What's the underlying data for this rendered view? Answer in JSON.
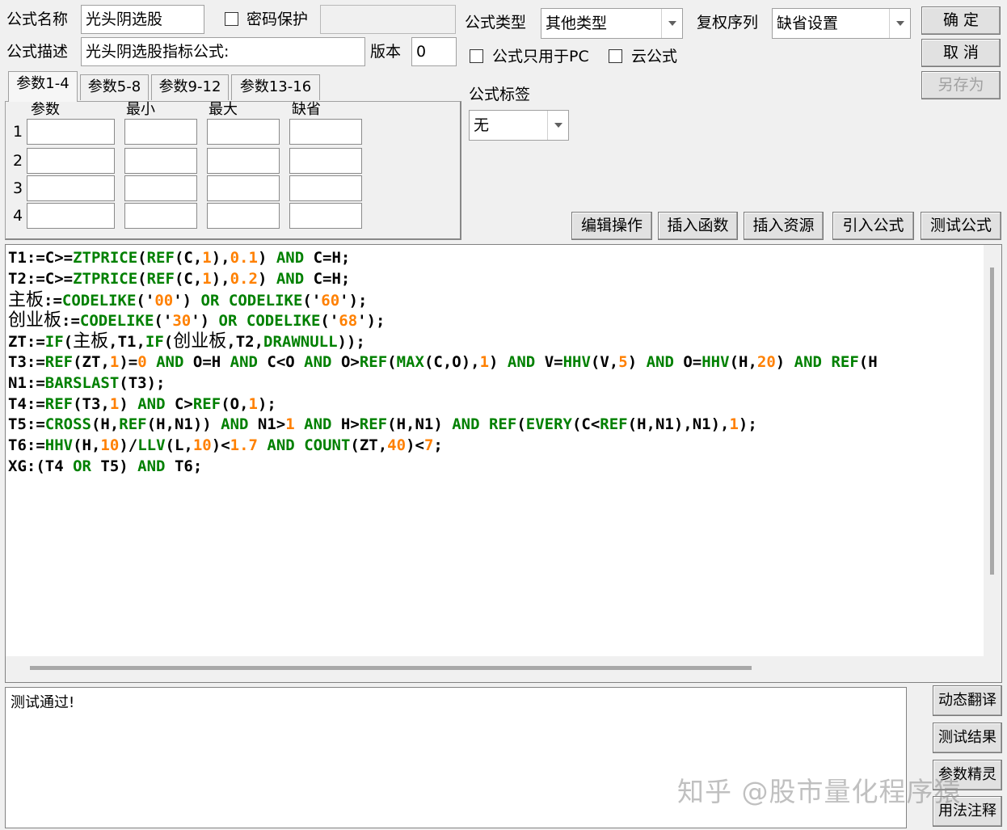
{
  "top": {
    "formula_name_label": "公式名称",
    "formula_name_value": "光头阴选股",
    "password_label": "密码保护",
    "password_value": "",
    "formula_desc_label": "公式描述",
    "formula_desc_value": "光头阴选股指标公式:",
    "version_label": "版本",
    "version_value": "0",
    "formula_type_label": "公式类型",
    "formula_type_value": "其他类型",
    "restore_label": "复权序列",
    "restore_value": "缺省设置",
    "pc_only_label": "公式只用于PC",
    "cloud_label": "云公式",
    "tag_label": "公式标签",
    "tag_value": "无"
  },
  "buttons": {
    "ok": "确  定",
    "cancel": "取  消",
    "save_as": "另存为"
  },
  "param_tabs": [
    "参数1-4",
    "参数5-8",
    "参数9-12",
    "参数13-16"
  ],
  "param_headers": [
    "参数",
    "最小",
    "最大",
    "缺省"
  ],
  "param_rows": [
    "1",
    "2",
    "3",
    "4"
  ],
  "toolbar": [
    "编辑操作",
    "插入函数",
    "插入资源",
    "引入公式",
    "测试公式"
  ],
  "code_lines": [
    "T1:=C>=ZTPRICE(REF(C,1),0.1) AND C=H;",
    "T2:=C>=ZTPRICE(REF(C,1),0.2) AND C=H;",
    "主板:=CODELIKE('00') OR CODELIKE('60');",
    "创业板:=CODELIKE('30') OR CODELIKE('68');",
    "ZT:=IF(主板,T1,IF(创业板,T2,DRAWNULL));",
    "T3:=REF(ZT,1)=0 AND O=H AND C<O AND O>REF(MAX(C,O),1) AND V=HHV(V,5) AND O=HHV(H,20) AND REF(H",
    "N1:=BARSLAST(T3);",
    "T4:=REF(T3,1) AND C>REF(O,1);",
    "T5:=CROSS(H,REF(H,N1)) AND N1>1 AND H>REF(H,N1) AND REF(EVERY(C<REF(H,N1),N1),1);",
    "T6:=HHV(H,10)/LLV(L,10)<1.7 AND COUNT(ZT,40)<7;",
    "XG:(T4 OR T5) AND T6;"
  ],
  "result_text": "测试通过!",
  "side_buttons": [
    "动态翻译",
    "测试结果",
    "参数精灵",
    "用法注释"
  ],
  "watermark": "知乎 @股市量化程序猿",
  "colors": {
    "keyword": "#008000",
    "number": "#ff8000",
    "text": "#000000"
  }
}
